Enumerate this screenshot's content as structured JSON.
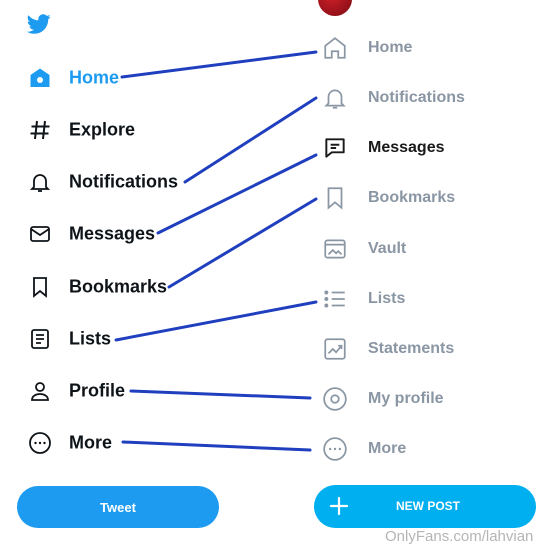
{
  "left_nav": {
    "items": [
      {
        "label": "Home",
        "icon": "home-icon"
      },
      {
        "label": "Explore",
        "icon": "hashtag-icon"
      },
      {
        "label": "Notifications",
        "icon": "bell-icon"
      },
      {
        "label": "Messages",
        "icon": "envelope-icon"
      },
      {
        "label": "Bookmarks",
        "icon": "bookmark-icon"
      },
      {
        "label": "Lists",
        "icon": "list-icon"
      },
      {
        "label": "Profile",
        "icon": "user-icon"
      },
      {
        "label": "More",
        "icon": "more-circle-icon"
      }
    ],
    "tweet_label": "Tweet"
  },
  "right_nav": {
    "items": [
      {
        "label": "Home",
        "icon": "home-icon"
      },
      {
        "label": "Notifications",
        "icon": "bell-icon"
      },
      {
        "label": "Messages",
        "icon": "message-icon"
      },
      {
        "label": "Bookmarks",
        "icon": "bookmark-icon"
      },
      {
        "label": "Vault",
        "icon": "vault-icon"
      },
      {
        "label": "Lists",
        "icon": "list-icon"
      },
      {
        "label": "Statements",
        "icon": "chart-icon"
      },
      {
        "label": "My profile",
        "icon": "user-circle-icon"
      },
      {
        "label": "More",
        "icon": "more-circle-icon"
      }
    ],
    "new_post_label": "NEW POST"
  },
  "watermark": "OnlyFans.com/lahvian",
  "colors": {
    "twitter_blue": "#1d9bf0",
    "onlyfans_blue": "#00aff0",
    "connector_line": "#1f3fbf",
    "muted_text": "#8a96a3"
  }
}
